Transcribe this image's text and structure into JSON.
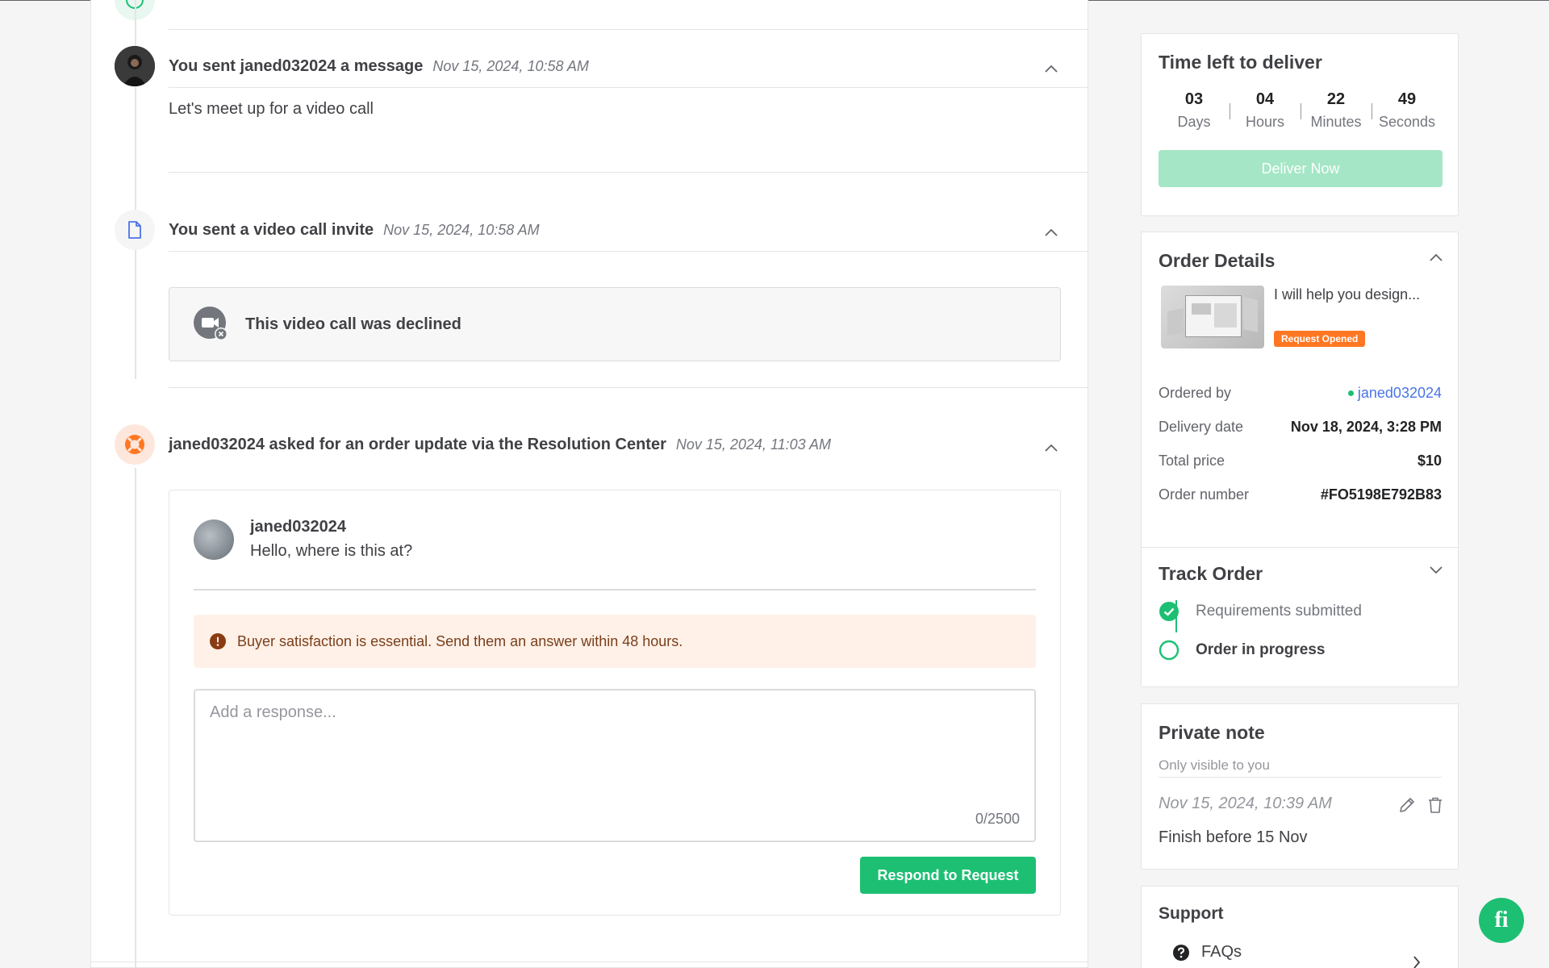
{
  "timeline": {
    "events": [
      {
        "title": "You sent janed032024 a message",
        "time": "Nov 15, 2024, 10:58 AM",
        "body": "Let's meet up for a video call"
      },
      {
        "title": "You sent a video call invite",
        "time": "Nov 15, 2024, 10:58 AM",
        "body": "This video call was declined"
      },
      {
        "title": "janed032024 asked for an order update via the Resolution Center",
        "time": "Nov 15, 2024, 11:03 AM"
      }
    ],
    "resolution": {
      "buyer_name": "janed032024",
      "buyer_message": "Hello, where is this at?",
      "warning": "Buyer satisfaction is essential. Send them an answer within 48 hours.",
      "response_placeholder": "Add a response...",
      "response_value": "",
      "char_counter": "0/2500",
      "respond_label": "Respond to Request"
    }
  },
  "sidebar": {
    "time_left": {
      "title": "Time left to deliver",
      "units": [
        {
          "value": "03",
          "label": "Days"
        },
        {
          "value": "04",
          "label": "Hours"
        },
        {
          "value": "22",
          "label": "Minutes"
        },
        {
          "value": "49",
          "label": "Seconds"
        }
      ],
      "deliver_label": "Deliver Now"
    },
    "order_details": {
      "title": "Order Details",
      "gig_title": "I will help you design...",
      "status_badge": "Request Opened",
      "rows": [
        {
          "label": "Ordered by",
          "value": "janed032024"
        },
        {
          "label": "Delivery date",
          "value": "Nov 18, 2024, 3:28 PM"
        },
        {
          "label": "Total price",
          "value": "$10"
        },
        {
          "label": "Order number",
          "value": "#FO5198E792B83"
        }
      ]
    },
    "track_order": {
      "title": "Track Order",
      "steps": [
        {
          "label": "Requirements submitted",
          "state": "done"
        },
        {
          "label": "Order in progress",
          "state": "active"
        }
      ]
    },
    "private_note": {
      "title": "Private note",
      "subtitle": "Only visible to you",
      "time": "Nov 15, 2024, 10:39 AM",
      "text": "Finish before 15 Nov"
    },
    "support": {
      "title": "Support",
      "items": [
        {
          "label": "FAQs"
        }
      ]
    }
  },
  "colors": {
    "brand_green": "#1dbf73",
    "warning_orange": "#ff7722",
    "link_blue": "#4a73e8"
  },
  "icons": {
    "chat_fab": "fiverr-logo-icon"
  }
}
